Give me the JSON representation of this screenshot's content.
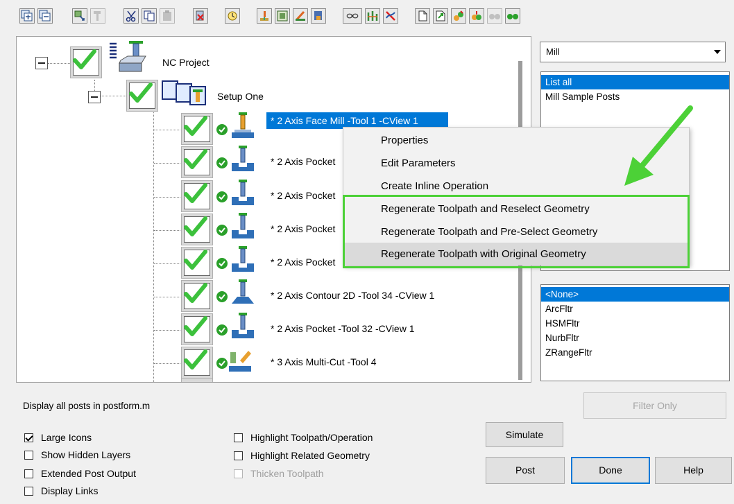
{
  "toolbar": {
    "buttons": [
      {
        "icon": "select-all-icon"
      },
      {
        "icon": "select-tools-icon"
      },
      {
        "icon": "regenerate-all-icon"
      },
      {
        "icon": "regenerate-dirty-icon"
      },
      {
        "icon": "cut-icon"
      },
      {
        "icon": "copy-icon"
      },
      {
        "icon": "paste-icon"
      },
      {
        "icon": "delete-icon"
      },
      {
        "icon": "lock-icon"
      },
      {
        "icon": "backplot-icon"
      },
      {
        "icon": "verify-icon"
      },
      {
        "icon": "highlight-icon"
      },
      {
        "icon": "post-icon"
      },
      {
        "icon": "link-icon"
      },
      {
        "icon": "toggle-display-icon"
      },
      {
        "icon": "remove-toolpath-icon"
      },
      {
        "icon": "new-file-icon"
      },
      {
        "icon": "insert-arrow-icon"
      },
      {
        "icon": "expand-all-icon"
      },
      {
        "icon": "collapse-all-icon"
      },
      {
        "icon": "scroll-up-icon"
      },
      {
        "icon": "scroll-down-icon"
      }
    ]
  },
  "tree": {
    "root_label": "NC Project",
    "setup_label": "Setup One",
    "operations": [
      {
        "label": "* 2 Axis Face Mill -Tool 1 -CView 1",
        "selected": true,
        "icon": "face-mill-icon"
      },
      {
        "label": "* 2 Axis Pocket",
        "icon": "pocket-icon"
      },
      {
        "label": "* 2 Axis Pocket",
        "icon": "pocket-icon"
      },
      {
        "label": "* 2 Axis Pocket",
        "icon": "pocket-icon"
      },
      {
        "label": "* 2 Axis Pocket",
        "icon": "pocket-icon"
      },
      {
        "label": "* 2 Axis Contour 2D  -Tool 34 -CView 1",
        "icon": "contour-icon"
      },
      {
        "label": "* 2 Axis Pocket  -Tool 32 -CView 1",
        "icon": "pocket-icon"
      },
      {
        "label": "* 3 Axis Multi-Cut  -Tool 4",
        "icon": "multi-cut-icon"
      }
    ]
  },
  "context_menu": {
    "items": [
      "Properties",
      "Edit Parameters",
      "Create Inline Operation",
      "Regenerate Toolpath and Reselect Geometry",
      "Regenerate Toolpath and Pre-Select Geometry",
      "Regenerate Toolpath with Original Geometry"
    ],
    "highlight_color": "#4cd137"
  },
  "machine": {
    "selected": "Mill"
  },
  "posts": {
    "items": [
      "List all",
      "Mill Sample Posts"
    ],
    "selected_index": 0
  },
  "filters": {
    "items": [
      "<None>",
      "ArcFltr",
      "HSMFltr",
      "NurbFltr",
      "ZRangeFltr"
    ],
    "selected_index": 0
  },
  "status": {
    "text": "Display all posts in postform.m"
  },
  "options": {
    "large_icons": {
      "label": "Large Icons",
      "checked": true
    },
    "show_hidden_layers": {
      "label": "Show Hidden Layers",
      "checked": false
    },
    "extended_post_output": {
      "label": "Extended Post Output",
      "checked": false
    },
    "display_links": {
      "label": "Display Links",
      "checked": false
    },
    "highlight_toolpath": {
      "label": "Highlight Toolpath/Operation",
      "checked": false
    },
    "highlight_geometry": {
      "label": "Highlight Related Geometry",
      "checked": false
    },
    "thicken_toolpath": {
      "label": "Thicken Toolpath",
      "checked": false,
      "disabled": true
    }
  },
  "buttons": {
    "filter_only": "Filter Only",
    "simulate": "Simulate",
    "post": "Post",
    "done": "Done",
    "help": "Help"
  },
  "colors": {
    "selection": "#0078d7",
    "check_green": "#3cc13c",
    "arrow_green": "#4cd137"
  }
}
